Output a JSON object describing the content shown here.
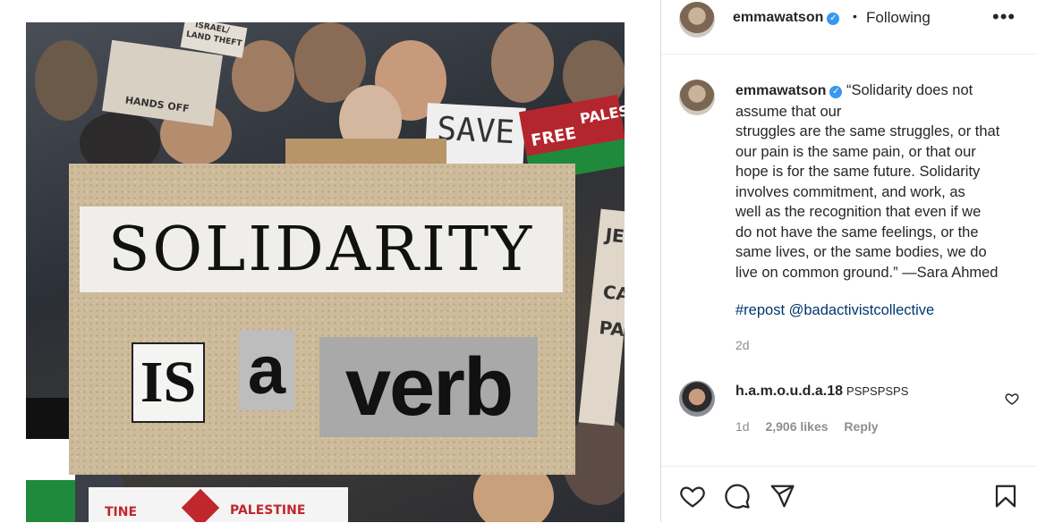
{
  "post": {
    "image": {
      "sign_solidarity": "SOLIDARITY",
      "sign_is": "IS",
      "sign_a": "a",
      "sign_verb": "verb",
      "bg_sign_save": "SAVE",
      "bg_sign_free": "FREE",
      "bg_sign_pales": "PALES",
      "bg_sign_hands": "HANDS OFF",
      "bg_sign_israel": "ISRAEL/",
      "bg_sign_land": "LAND THEFT",
      "bg_flag_left": "TINE",
      "bg_flag_right": "PALESTINE",
      "bg_sign_je": "JE",
      "bg_sign_ca": "CA",
      "bg_sign_pa": "PA"
    }
  },
  "header": {
    "username": "emmawatson",
    "separator": "•",
    "follow_status": "Following",
    "more": "•••"
  },
  "caption": {
    "username": "emmawatson",
    "lines": [
      "“Solidarity does not",
      "assume that our",
      "struggles are the same struggles, or that",
      "our pain is the same pain, or that our",
      "hope is for the same future. Solidarity",
      "involves commitment, and work, as",
      "well as the recognition that even if we",
      "do not have the same feelings, or the",
      "same lives, or the same bodies, we do",
      "live on common ground.” —Sara Ahmed"
    ],
    "tags": "#repost @badactivistcollective",
    "time": "2d"
  },
  "comment": {
    "username": "h.a.m.o.u.d.a.18",
    "text": "PSPSPSPS",
    "time": "1d",
    "likes": "2,906 likes",
    "reply": "Reply"
  },
  "colors": {
    "verified": "#3897f0",
    "link": "#00376b",
    "muted": "#8e8e8e",
    "text": "#262626"
  },
  "icons": [
    "heart-icon",
    "comment-icon",
    "share-icon",
    "bookmark-icon",
    "verified-icon",
    "more-icon"
  ]
}
